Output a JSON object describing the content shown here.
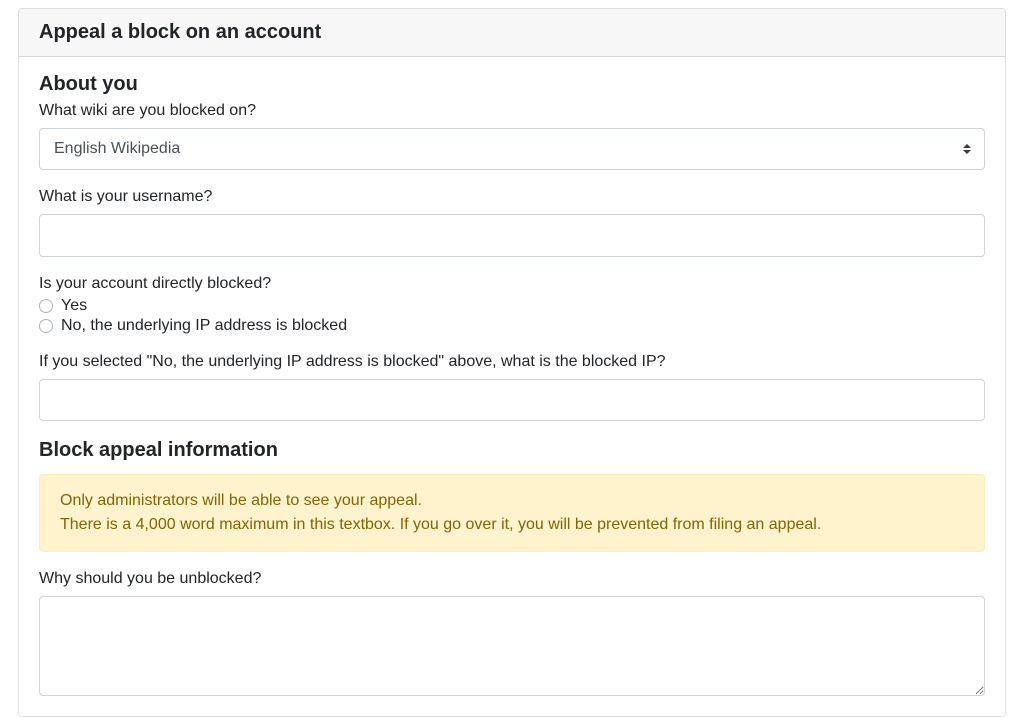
{
  "header": {
    "title": "Appeal a block on an account"
  },
  "about_you": {
    "heading": "About you",
    "wiki_label": "What wiki are you blocked on?",
    "wiki_selected": "English Wikipedia",
    "username_label": "What is your username?",
    "username_value": "",
    "directly_blocked_label": "Is your account directly blocked?",
    "radio_yes": "Yes",
    "radio_no": "No, the underlying IP address is blocked",
    "ip_label": "If you selected \"No, the underlying IP address is blocked\" above, what is the blocked IP?",
    "ip_value": ""
  },
  "block_appeal": {
    "heading": "Block appeal information",
    "alert_line1": "Only administrators will be able to see your appeal.",
    "alert_line2": "There is a 4,000 word maximum in this textbox. If you go over it, you will be prevented from filing an appeal.",
    "reason_label": "Why should you be unblocked?",
    "reason_value": ""
  }
}
